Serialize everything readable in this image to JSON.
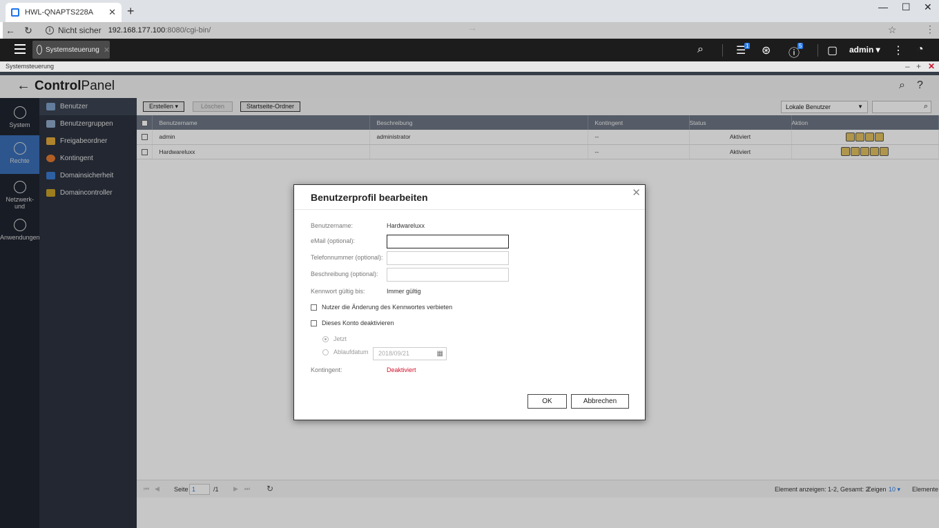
{
  "browser": {
    "tab_title": "HWL-QNAPTS228A",
    "security": "Nicht sicher",
    "url_host": "192.168.177.100",
    "url_rest": ":8080/cgi-bin/"
  },
  "qnap_topbar": {
    "app_tab": "Systemsteuerung",
    "task_badge": "1",
    "info_badge": "5",
    "user": "admin"
  },
  "window": {
    "title": "Systemsteuerung"
  },
  "control_panel": {
    "title_bold": "Control",
    "title_light": "Panel"
  },
  "rail": [
    {
      "label": "System"
    },
    {
      "label": "Rechte"
    },
    {
      "label": "Netzwerk- und"
    },
    {
      "label": "Anwendungen"
    }
  ],
  "submenu": [
    {
      "label": "Benutzer"
    },
    {
      "label": "Benutzergruppen"
    },
    {
      "label": "Freigabeordner"
    },
    {
      "label": "Kontingent"
    },
    {
      "label": "Domainsicherheit"
    },
    {
      "label": "Domaincontroller"
    }
  ],
  "toolbar": {
    "create": "Erstellen",
    "delete": "Löschen",
    "home_folder": "Startseite-Ordner",
    "filter": "Lokale Benutzer"
  },
  "table": {
    "headers": [
      "Benutzername",
      "Beschreibung",
      "Kontingent",
      "Status",
      "Aktion"
    ],
    "rows": [
      {
        "name": "admin",
        "description": "administrator",
        "quota": "--",
        "status": "Aktiviert"
      },
      {
        "name": "Hardwareluxx",
        "description": "",
        "quota": "--",
        "status": "Aktiviert"
      }
    ]
  },
  "pager": {
    "page_label": "Seite",
    "page": "1",
    "total": "/1",
    "summary": "Element anzeigen: 1-2, Gesamt: 2",
    "show_label": "Zeigen",
    "per_page": "10",
    "items_label": "Elemente"
  },
  "modal": {
    "title": "Benutzerprofil bearbeiten",
    "username_label": "Benutzername:",
    "username_value": "Hardwareluxx",
    "email_label": "eMail (optional):",
    "phone_label": "Telefonnummer (optional):",
    "desc_label": "Beschreibung (optional):",
    "pw_valid_label": "Kennwort gültig bis:",
    "pw_valid_value": "Immer gültig",
    "forbid_pw_change": "Nutzer die Änderung des Kennwortes verbieten",
    "disable_account": "Dieses Konto deaktivieren",
    "radio_now": "Jetzt",
    "radio_expiry": "Ablaufdatum",
    "expiry_date": "2018/09/21",
    "quota_label": "Kontingent:",
    "quota_value": "Deaktiviert",
    "ok": "OK",
    "cancel": "Abbrechen"
  },
  "colors": {
    "accent": "#3a6fb8",
    "danger": "#d0112b",
    "header_dark": "#1c1c1c"
  }
}
